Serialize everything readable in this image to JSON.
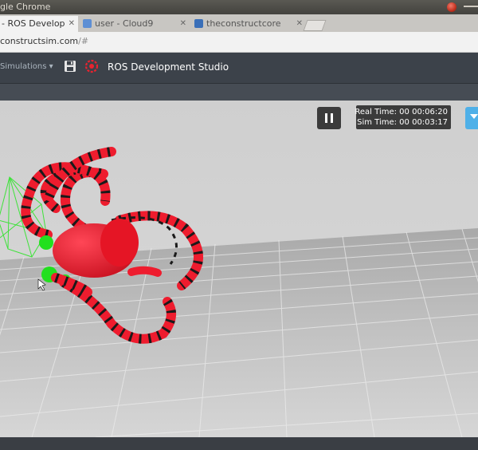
{
  "window": {
    "title": "gle Chrome"
  },
  "tabs": [
    {
      "label": "- ROS Develop",
      "active": true
    },
    {
      "label": "user - Cloud9",
      "active": false
    },
    {
      "label": "theconstructcore",
      "active": false
    }
  ],
  "address": {
    "host": "constructsim.com",
    "path": "/#"
  },
  "toolbar": {
    "menu_label": "Simulations",
    "app_title": "ROS Development Studio"
  },
  "sim": {
    "real_time_label": "Real Time:",
    "real_time": "00 00:06:20",
    "sim_time_label": "Sim Time:",
    "sim_time": "00 00:03:17"
  },
  "colors": {
    "robot": "#ee1c2e",
    "stripes": "#1a1a1a",
    "joint": "#22e01e",
    "toolbar": "#3c424a",
    "accent": "#4fb0e8"
  },
  "icons": {
    "save": "floppy-disk-icon",
    "ros": "ros-logo-icon",
    "pause": "pause-icon"
  }
}
